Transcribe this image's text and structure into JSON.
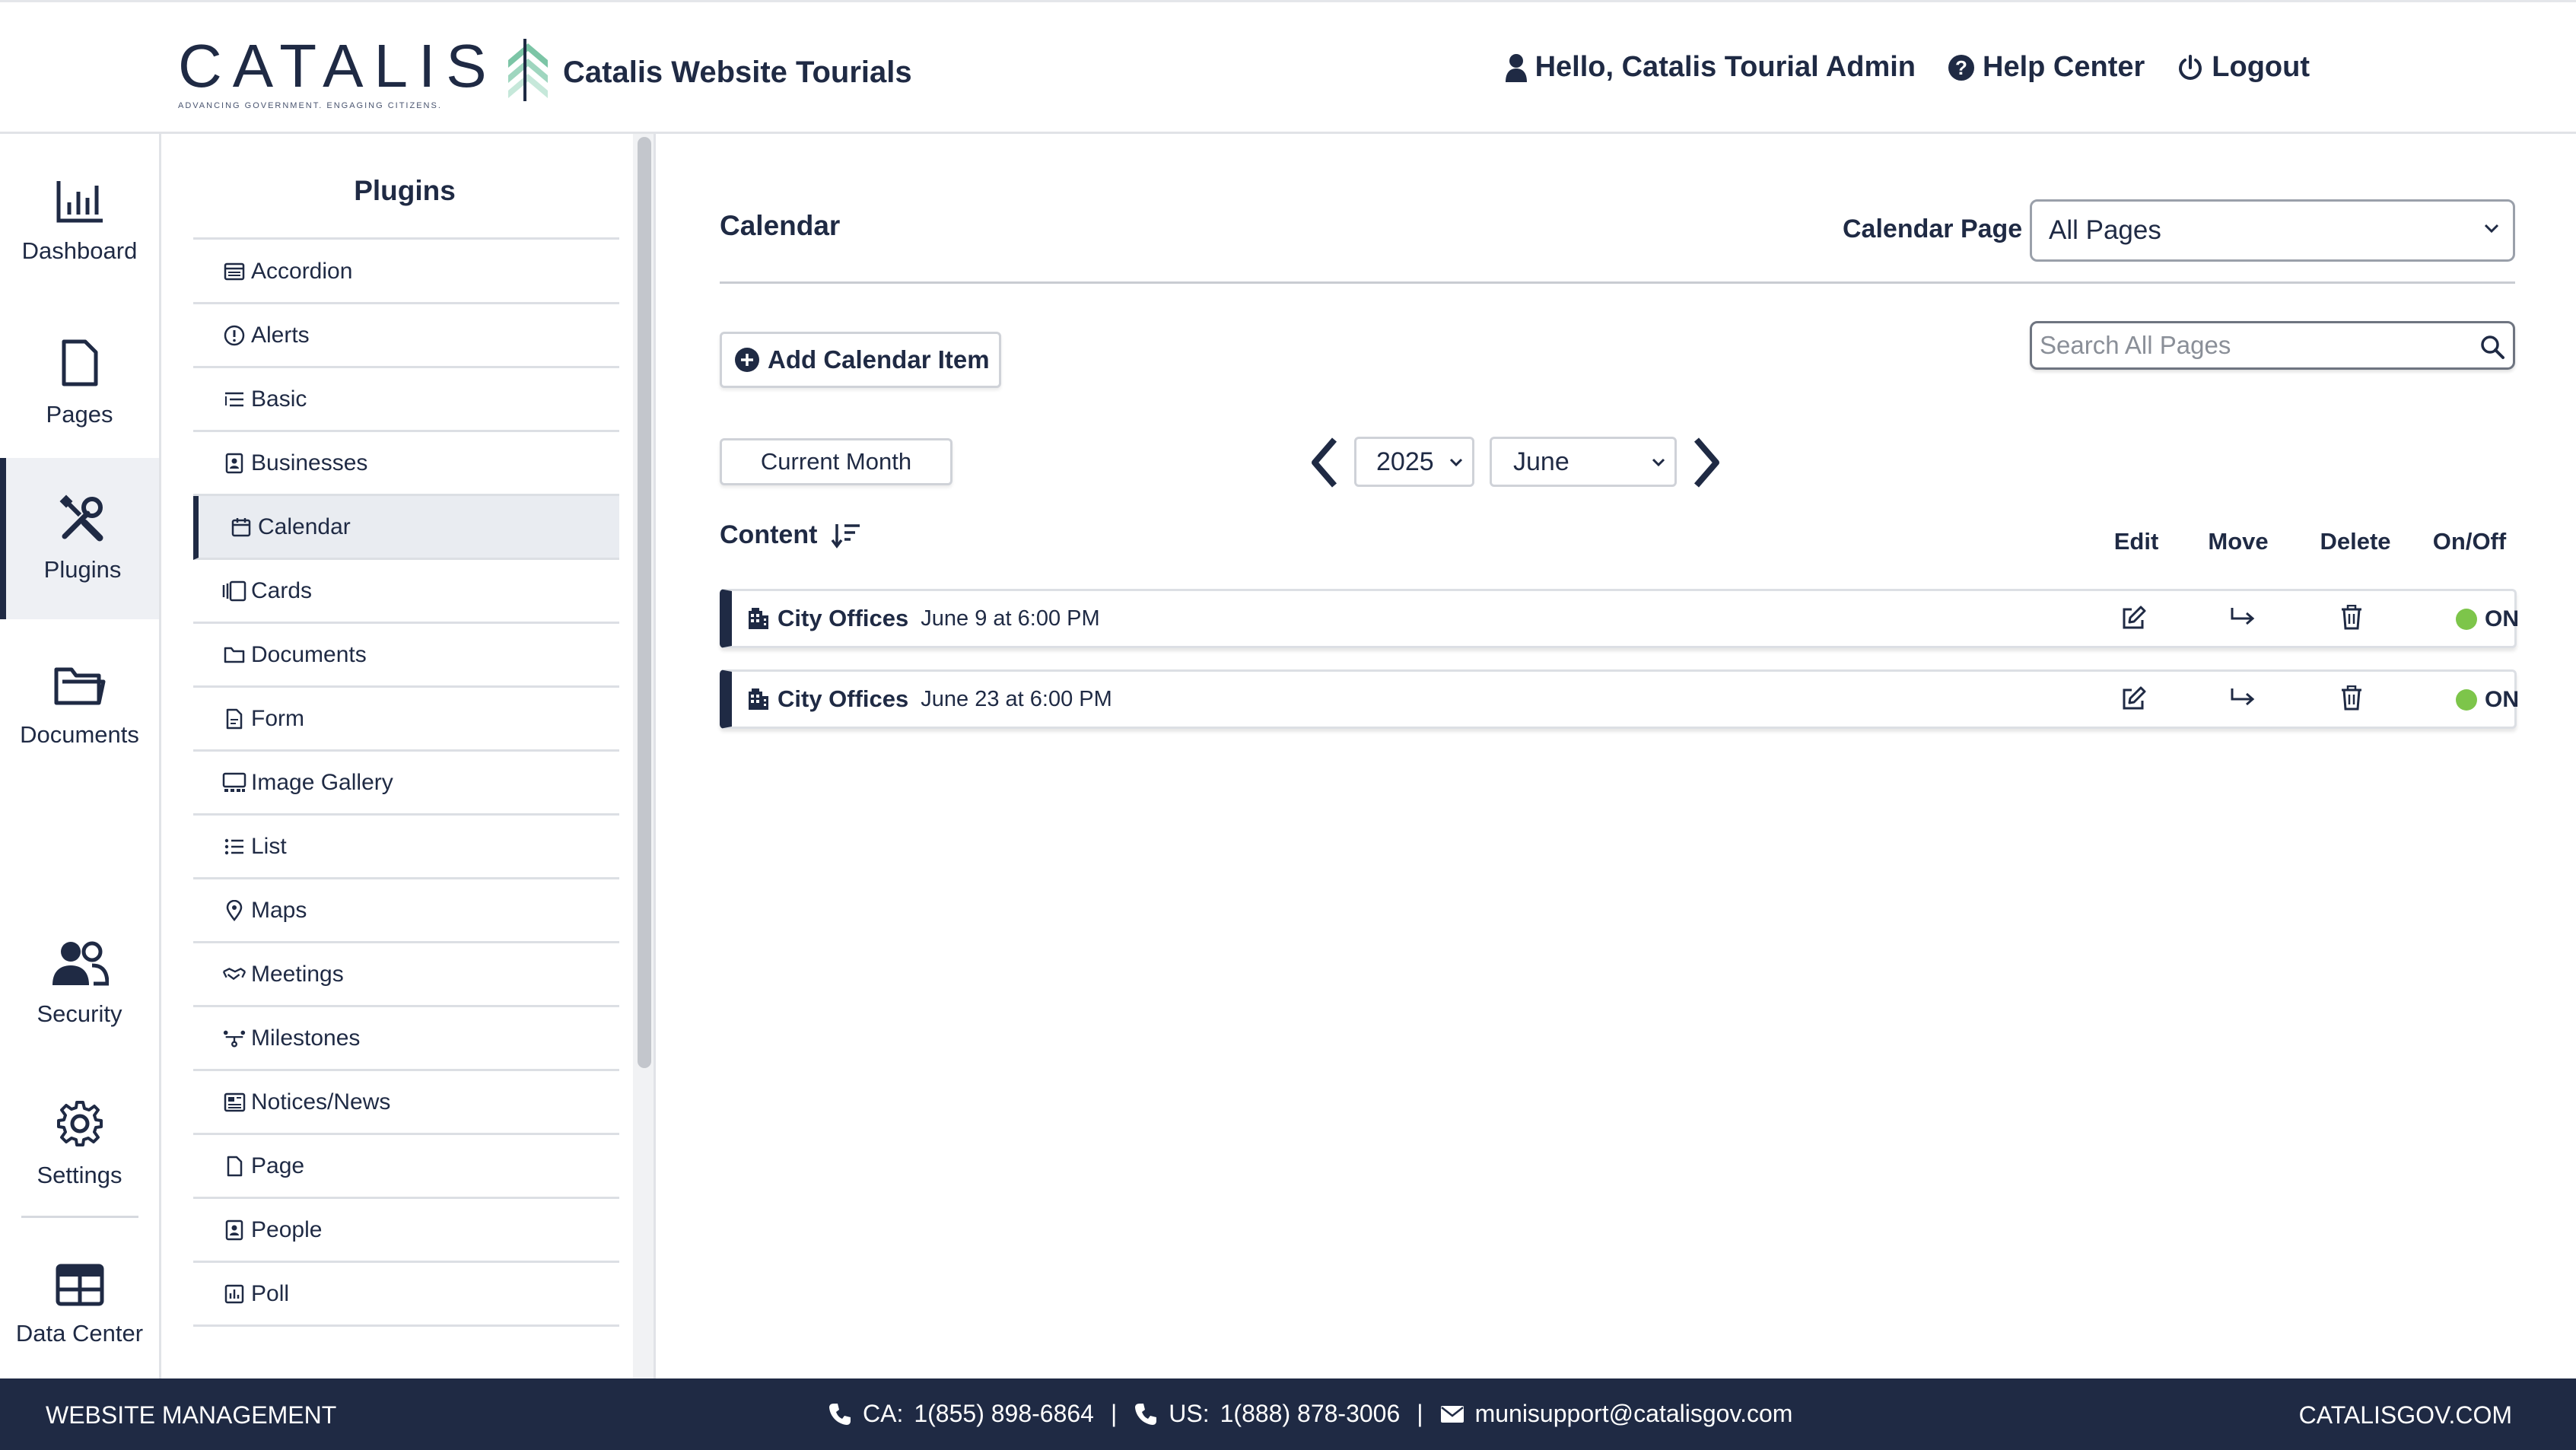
{
  "colors": {
    "navy": "#1f2a44",
    "on_green": "#7dc54a",
    "logo_green": "#7cc5a6"
  },
  "header": {
    "logo_text": "CATALIS",
    "logo_tagline": "ADVANCING GOVERNMENT. ENGAGING CITIZENS.",
    "logo_mark_icon": "chevron-stack-icon",
    "site_title": "Catalis Website Tourials",
    "greeting": "Hello, Catalis Tourial Admin",
    "help": "Help Center",
    "logout": "Logout"
  },
  "rail": {
    "items": [
      {
        "label": "Dashboard",
        "icon": "bar-chart-icon"
      },
      {
        "label": "Pages",
        "icon": "page-icon"
      },
      {
        "label": "Plugins",
        "icon": "tools-icon",
        "active": true
      },
      {
        "label": "Documents",
        "icon": "folder-icon"
      },
      {
        "label": "Security",
        "icon": "users-icon"
      },
      {
        "label": "Settings",
        "icon": "gear-icon"
      },
      {
        "label": "Data Center",
        "icon": "table-icon"
      }
    ]
  },
  "plugins": {
    "title": "Plugins",
    "items": [
      {
        "label": "Accordion",
        "icon": "accordion-icon"
      },
      {
        "label": "Alerts",
        "icon": "alert-icon"
      },
      {
        "label": "Basic",
        "icon": "basic-icon"
      },
      {
        "label": "Businesses",
        "icon": "contact-card-icon"
      },
      {
        "label": "Calendar",
        "icon": "calendar-icon",
        "active": true
      },
      {
        "label": "Cards",
        "icon": "cards-icon"
      },
      {
        "label": "Documents",
        "icon": "folder-icon"
      },
      {
        "label": "Form",
        "icon": "form-icon"
      },
      {
        "label": "Image Gallery",
        "icon": "gallery-icon"
      },
      {
        "label": "List",
        "icon": "list-icon"
      },
      {
        "label": "Maps",
        "icon": "map-pin-icon"
      },
      {
        "label": "Meetings",
        "icon": "handshake-icon"
      },
      {
        "label": "Milestones",
        "icon": "milestones-icon"
      },
      {
        "label": "Notices/News",
        "icon": "newspaper-icon"
      },
      {
        "label": "Page",
        "icon": "page-icon"
      },
      {
        "label": "People",
        "icon": "contact-card-icon"
      },
      {
        "label": "Poll",
        "icon": "poll-icon"
      }
    ]
  },
  "main": {
    "heading": "Calendar",
    "calendar_page_label": "Calendar Page",
    "calendar_page_value": "All Pages",
    "add_button": "Add Calendar Item",
    "search_placeholder": "Search All Pages",
    "current_month": "Current Month",
    "year": "2025",
    "month": "June",
    "content_label": "Content",
    "columns": {
      "edit": "Edit",
      "move": "Move",
      "delete": "Delete",
      "onoff": "On/Off"
    },
    "rows": [
      {
        "title": "City Offices",
        "date": "June 9 at 6:00 PM",
        "status": "ON"
      },
      {
        "title": "City Offices",
        "date": "June 23 at 6:00 PM",
        "status": "ON"
      }
    ]
  },
  "footer": {
    "left": "WEBSITE MANAGEMENT",
    "ca_label": "CA:",
    "ca_phone": "1(855) 898-6864",
    "us_label": "US:",
    "us_phone": "1(888) 878-3006",
    "email": "munisupport@catalisgov.com",
    "right": "CATALISGOV.COM"
  }
}
